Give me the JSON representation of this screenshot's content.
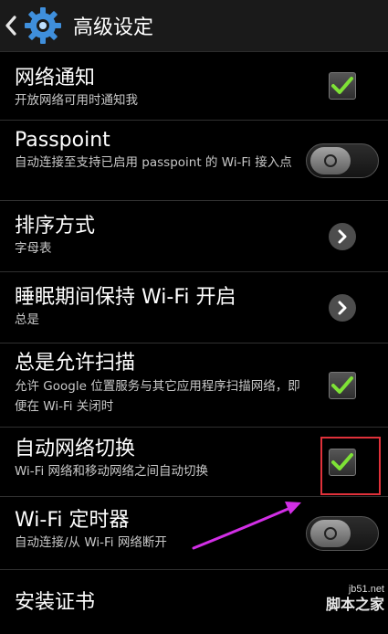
{
  "header": {
    "title": "高级设定"
  },
  "items": [
    {
      "title": "网络通知",
      "subtitle": "开放网络可用时通知我",
      "control": "checkbox",
      "checked": true
    },
    {
      "title": "Passpoint",
      "subtitle": "自动连接至支持已启用 passpoint 的 Wi-Fi 接入点",
      "control": "toggle",
      "on": false
    },
    {
      "title": "排序方式",
      "subtitle": "字母表",
      "control": "chevron"
    },
    {
      "title": "睡眠期间保持 Wi-Fi 开启",
      "subtitle": "总是",
      "control": "chevron"
    },
    {
      "title": "总是允许扫描",
      "subtitle": "允许 Google 位置服务与其它应用程序扫描网络，即便在 Wi-Fi 关闭时",
      "control": "checkbox",
      "checked": true
    },
    {
      "title": "自动网络切换",
      "subtitle": "Wi-Fi 网络和移动网络之间自动切换",
      "control": "checkbox",
      "checked": true
    },
    {
      "title": "Wi-Fi 定时器",
      "subtitle": "自动连接/从 Wi-Fi 网络断开",
      "control": "toggle",
      "on": false
    },
    {
      "title": "安装证书",
      "subtitle": "",
      "control": "none"
    }
  ],
  "watermark": {
    "site": "jb51.net",
    "name": "脚本之家"
  },
  "colors": {
    "check": "#7ee236",
    "highlight": "#e0313a",
    "arrow": "#d22fe6",
    "background": "#000000"
  },
  "icons": {
    "back": "back-chevron-icon",
    "gear": "gear-icon",
    "chevron": "chevron-right-icon",
    "check": "checkmark-icon"
  }
}
